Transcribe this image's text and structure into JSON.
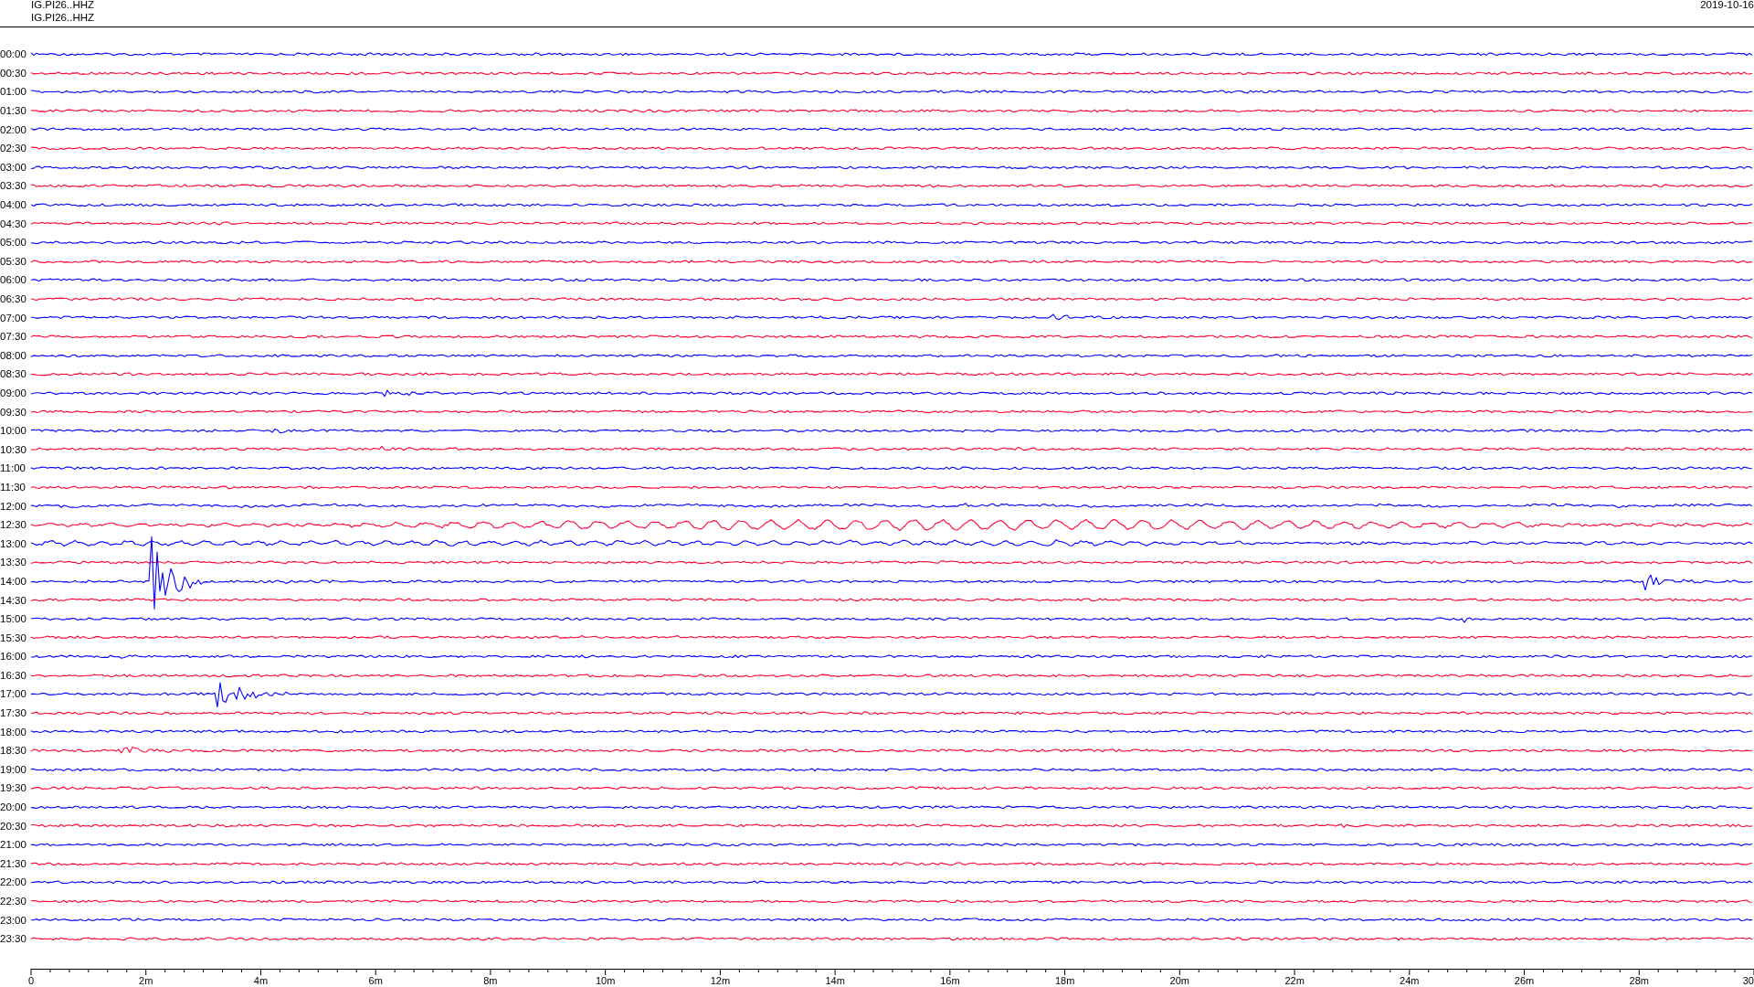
{
  "header": {
    "station_labels": [
      "IG.PI26..HHZ",
      "IG.PI26..HHZ"
    ],
    "date": "2019-10-16"
  },
  "rows": [
    {
      "time": "00:00",
      "color": "#0000ff"
    },
    {
      "time": "00:30",
      "color": "#ff0033"
    },
    {
      "time": "01:00",
      "color": "#0000ff"
    },
    {
      "time": "01:30",
      "color": "#ff0033"
    },
    {
      "time": "02:00",
      "color": "#0000ff"
    },
    {
      "time": "02:30",
      "color": "#ff0033"
    },
    {
      "time": "03:00",
      "color": "#0000ff"
    },
    {
      "time": "03:30",
      "color": "#ff0033"
    },
    {
      "time": "04:00",
      "color": "#0000ff"
    },
    {
      "time": "04:30",
      "color": "#ff0033"
    },
    {
      "time": "05:00",
      "color": "#0000ff"
    },
    {
      "time": "05:30",
      "color": "#ff0033"
    },
    {
      "time": "06:00",
      "color": "#0000ff"
    },
    {
      "time": "06:30",
      "color": "#ff0033"
    },
    {
      "time": "07:00",
      "color": "#0000ff"
    },
    {
      "time": "07:30",
      "color": "#ff0033"
    },
    {
      "time": "08:00",
      "color": "#0000ff"
    },
    {
      "time": "08:30",
      "color": "#ff0033"
    },
    {
      "time": "09:00",
      "color": "#0000ff"
    },
    {
      "time": "09:30",
      "color": "#ff0033"
    },
    {
      "time": "10:00",
      "color": "#0000ff"
    },
    {
      "time": "10:30",
      "color": "#ff0033"
    },
    {
      "time": "11:00",
      "color": "#0000ff"
    },
    {
      "time": "11:30",
      "color": "#ff0033"
    },
    {
      "time": "12:00",
      "color": "#0000ff"
    },
    {
      "time": "12:30",
      "color": "#ff0033"
    },
    {
      "time": "13:00",
      "color": "#0000ff"
    },
    {
      "time": "13:30",
      "color": "#ff0033"
    },
    {
      "time": "14:00",
      "color": "#0000ff"
    },
    {
      "time": "14:30",
      "color": "#ff0033"
    },
    {
      "time": "15:00",
      "color": "#0000ff"
    },
    {
      "time": "15:30",
      "color": "#ff0033"
    },
    {
      "time": "16:00",
      "color": "#0000ff"
    },
    {
      "time": "16:30",
      "color": "#ff0033"
    },
    {
      "time": "17:00",
      "color": "#0000ff"
    },
    {
      "time": "17:30",
      "color": "#ff0033"
    },
    {
      "time": "18:00",
      "color": "#0000ff"
    },
    {
      "time": "18:30",
      "color": "#ff0033"
    },
    {
      "time": "19:00",
      "color": "#0000ff"
    },
    {
      "time": "19:30",
      "color": "#ff0033"
    },
    {
      "time": "20:00",
      "color": "#0000ff"
    },
    {
      "time": "20:30",
      "color": "#ff0033"
    },
    {
      "time": "21:00",
      "color": "#0000ff"
    },
    {
      "time": "21:30",
      "color": "#ff0033"
    },
    {
      "time": "22:00",
      "color": "#0000ff"
    },
    {
      "time": "22:30",
      "color": "#ff0033"
    },
    {
      "time": "23:00",
      "color": "#0000ff"
    },
    {
      "time": "23:30",
      "color": "#ff0033"
    }
  ],
  "x_axis": {
    "tick_labels": [
      "0",
      "2m",
      "4m",
      "6m",
      "8m",
      "10m",
      "12m",
      "14m",
      "16m",
      "18m",
      "20m",
      "22m",
      "24m",
      "26m",
      "28m",
      "30"
    ]
  }
}
